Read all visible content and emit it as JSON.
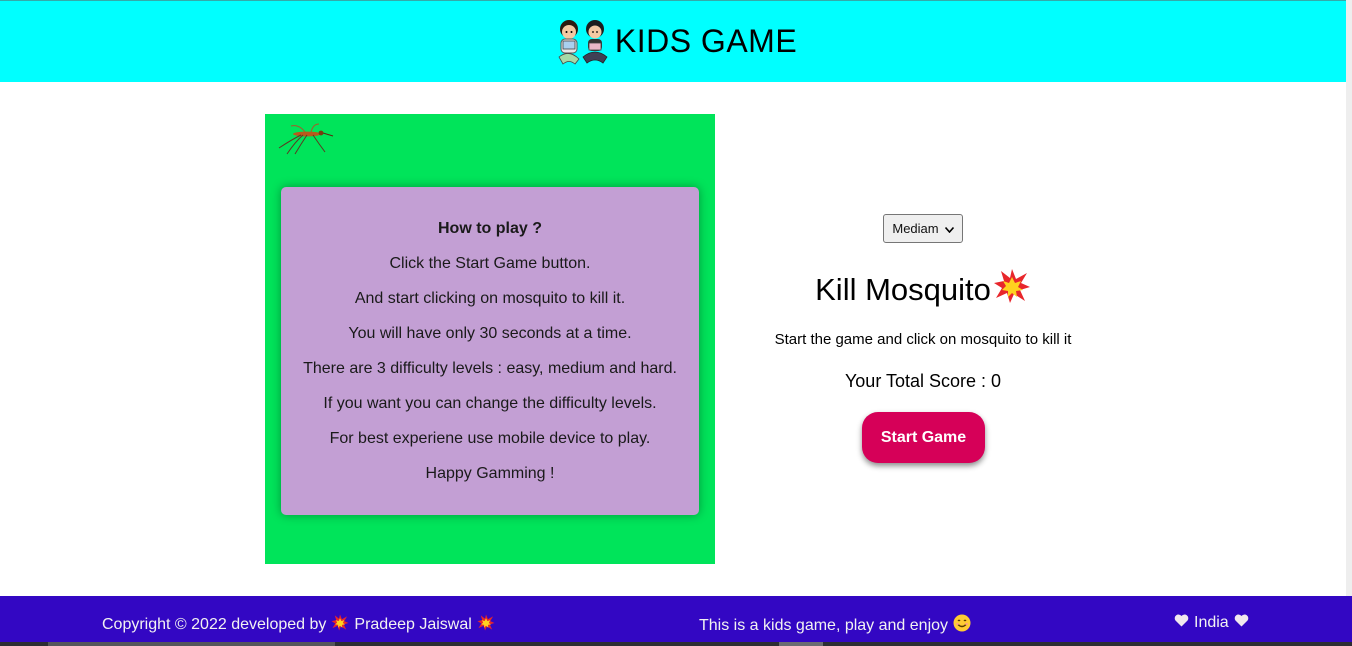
{
  "header": {
    "title": "KIDS GAME",
    "logo_icon": "kids-reading-icon"
  },
  "game": {
    "mosquito_icon": "mosquito-icon",
    "howto": {
      "title": "How to play ?",
      "lines": [
        "Click the Start Game button.",
        "And start clicking on mosquito to kill it.",
        "You will have only 30 seconds at a time.",
        "There are 3 difficulty levels : easy, medium and hard.",
        "If you want you can change the difficulty levels.",
        "For best experiene use mobile device to play.",
        "Happy Gamming !"
      ]
    }
  },
  "controls": {
    "difficulty_selected": "Mediam",
    "title": "Kill Mosquito",
    "title_icon": "collision-icon",
    "subtitle": "Start the game and click on mosquito to kill it",
    "score_label": "Your Total Score : 0",
    "start_button": "Start Game"
  },
  "footer": {
    "copyright_prefix": "Copyright © 2022 developed by",
    "author": "Pradeep Jaiswal",
    "tagline": "This is a kids game, play and enjoy",
    "country": "India"
  },
  "colors": {
    "header_bg": "#00ffff",
    "game_bg": "#00e45a",
    "howto_bg": "#c39fd4",
    "button_bg": "#d60058",
    "footer_bg": "#3307c3"
  }
}
